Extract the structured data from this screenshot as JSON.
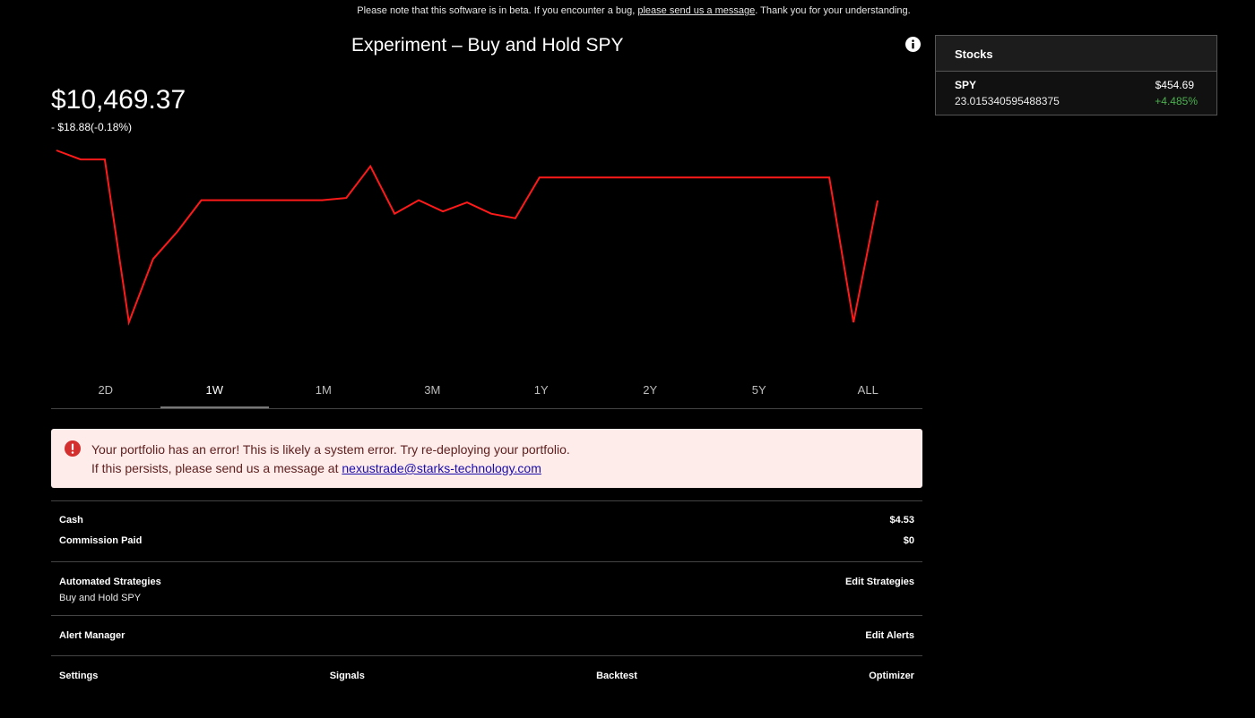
{
  "banner": {
    "prefix": "Please note that this software is in beta. If you encounter a bug,",
    "link": "please send us a message",
    "suffix": ". Thank you for your understanding."
  },
  "portfolio": {
    "title": "Experiment – Buy and Hold SPY",
    "value": "$10,469.37",
    "change": "- $18.88(-0.18%)"
  },
  "chart_data": {
    "type": "line",
    "color": "#ff1a1a",
    "series": [
      {
        "values": [
          10580,
          10560,
          10560,
          10200,
          10340,
          10400,
          10470,
          10470,
          10470,
          10470,
          10470,
          10470,
          10475,
          10545,
          10440,
          10470,
          10445,
          10465,
          10440,
          10430,
          10520,
          10520,
          10520,
          10520,
          10520,
          10520,
          10520,
          10520,
          10520,
          10520,
          10520,
          10520,
          10520,
          10200,
          10469.37
        ]
      }
    ]
  },
  "ranges": [
    "2D",
    "1W",
    "1M",
    "3M",
    "1Y",
    "2Y",
    "5Y",
    "ALL"
  ],
  "active_range": "1W",
  "alert": {
    "line1": "Your portfolio has an error! This is likely a system error. Try re-deploying your portfolio.",
    "line2_prefix": "If this persists, please send us a message at ",
    "email": "nexustrade@starks-technology.com"
  },
  "summary": {
    "cash_label": "Cash",
    "cash_value": "$4.53",
    "commission_label": "Commission Paid",
    "commission_value": "$0"
  },
  "strategies": {
    "label": "Automated Strategies",
    "edit": "Edit Strategies",
    "items": [
      "Buy and Hold SPY"
    ]
  },
  "alerts_manager": {
    "label": "Alert Manager",
    "edit": "Edit Alerts"
  },
  "bottom_nav": [
    "Settings",
    "Signals",
    "Backtest",
    "Optimizer"
  ],
  "stocks": {
    "header": "Stocks",
    "items": [
      {
        "symbol": "SPY",
        "shares": "23.015340595488375",
        "price": "$454.69",
        "change": "+4.485%"
      }
    ]
  },
  "colors": {
    "positive": "#4caf50",
    "line": "#ff1a1a",
    "alert_bg": "#fdecea",
    "alert_icon": "#d32f2f"
  },
  "icons": {
    "info": "info-icon",
    "alert": "error-icon"
  }
}
